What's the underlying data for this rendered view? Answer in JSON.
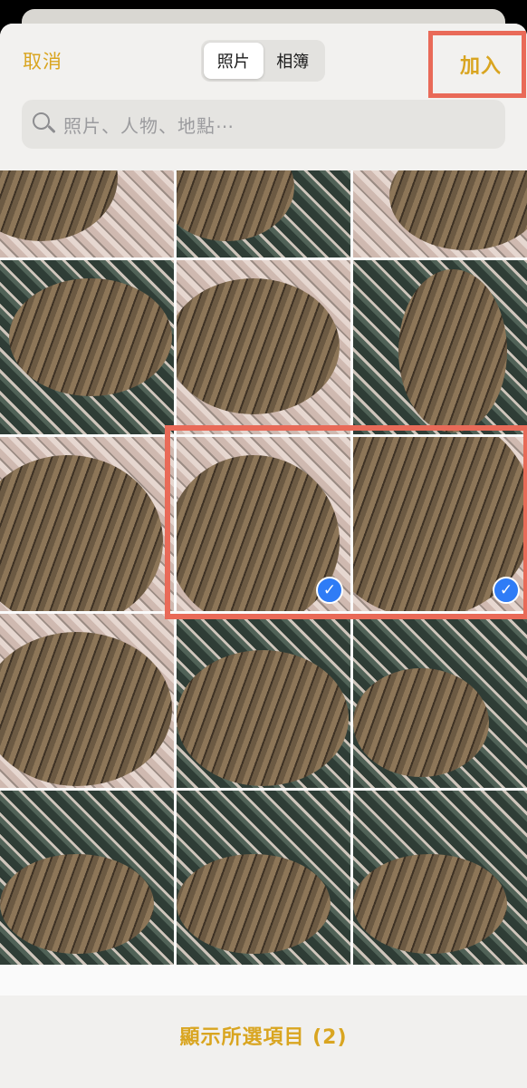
{
  "header": {
    "cancel_label": "取消",
    "tabs": [
      {
        "label": "照片",
        "selected": true
      },
      {
        "label": "相簿",
        "selected": false
      }
    ],
    "add_label": "加入"
  },
  "search": {
    "placeholder": "照片、人物、地點⋯"
  },
  "photos": [
    {
      "selected": false
    },
    {
      "selected": false
    },
    {
      "selected": false
    },
    {
      "selected": false
    },
    {
      "selected": false
    },
    {
      "selected": false
    },
    {
      "selected": false
    },
    {
      "selected": true
    },
    {
      "selected": true
    },
    {
      "selected": false
    },
    {
      "selected": false
    },
    {
      "selected": false
    },
    {
      "selected": false
    },
    {
      "selected": false
    },
    {
      "selected": false
    }
  ],
  "footer": {
    "show_selected_label": "顯示所選項目 (2)"
  },
  "colors": {
    "accent": "#d9a520",
    "highlight": "#e96a58",
    "checkmark": "#2f7cf6"
  }
}
